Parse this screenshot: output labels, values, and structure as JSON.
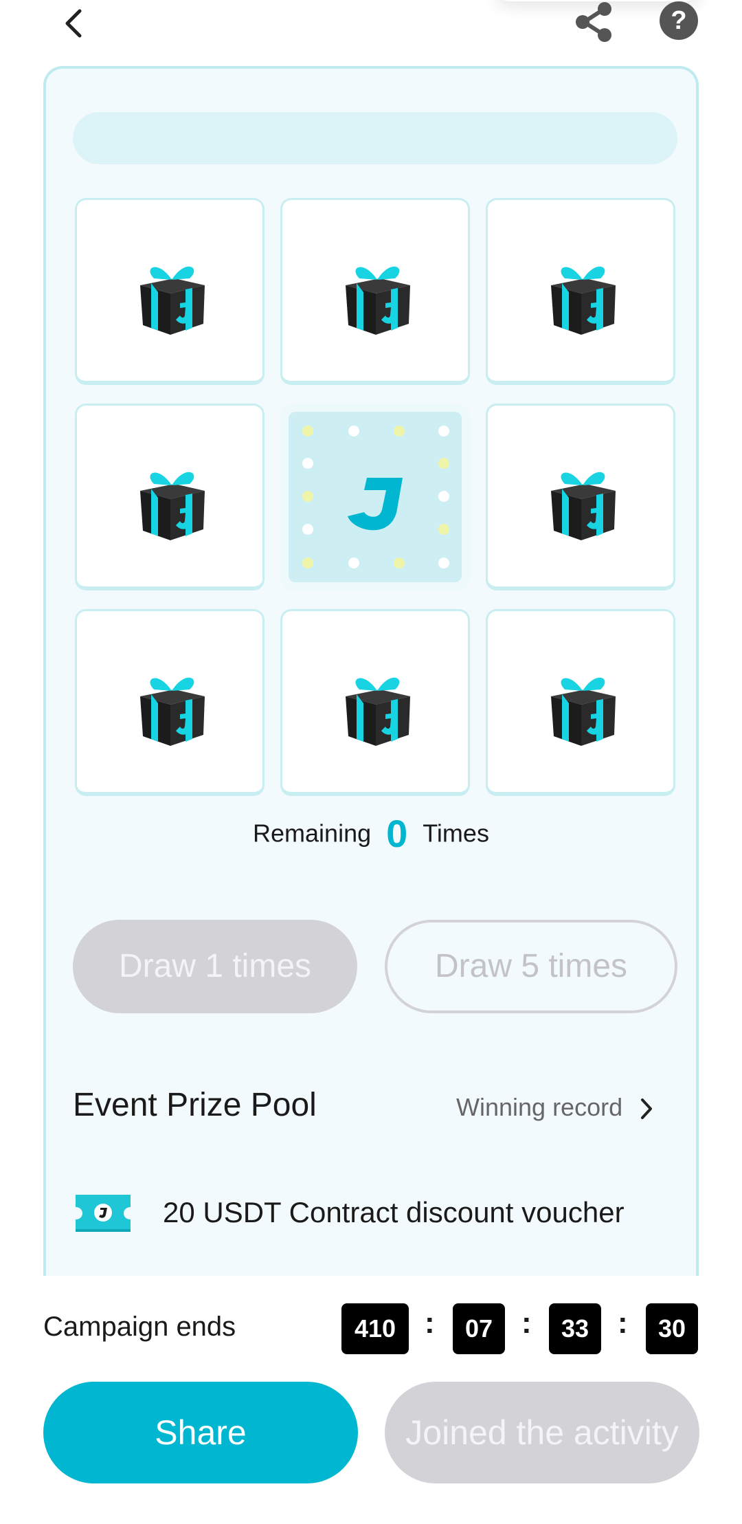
{
  "header": {
    "back_icon": "chevron-left-icon",
    "share_icon": "share-icon",
    "help_label": "?"
  },
  "grid": {
    "prize_icon": "gift-box-icon",
    "center_logo": "J",
    "accent_color": "#00b6d0"
  },
  "remaining": {
    "prefix": "Remaining",
    "count": "0",
    "suffix": "Times"
  },
  "draw": {
    "draw_one_label": "Draw 1 times",
    "draw_five_label": "Draw 5 times"
  },
  "prize_pool": {
    "title": "Event Prize Pool",
    "winning_record_label": "Winning record",
    "items": [
      {
        "icon": "voucher-ticket-icon",
        "label": "20 USDT Contract discount voucher"
      }
    ]
  },
  "campaign": {
    "label": "Campaign ends",
    "days": "410",
    "hours": "07",
    "minutes": "33",
    "seconds": "30",
    "separator": ":"
  },
  "footer": {
    "share_label": "Share",
    "joined_label": "Joined the activity"
  }
}
